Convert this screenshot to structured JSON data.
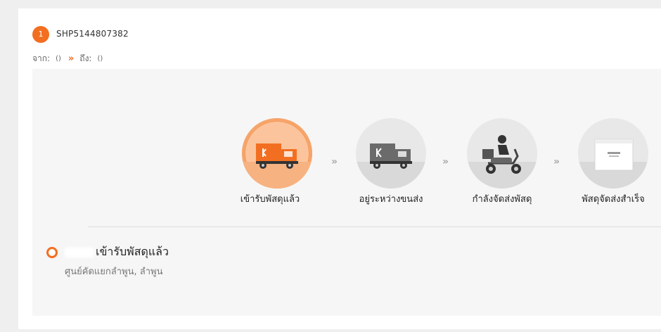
{
  "shipment": {
    "index": "1",
    "tracking_number": "SHP5144807382",
    "from_label": "จาก:",
    "from_value": "()",
    "to_label": "ถึง:",
    "to_value": "()",
    "route_arrow": "»"
  },
  "steps": [
    {
      "label": "เข้ารับพัสดุแล้ว",
      "icon": "orange-truck-icon",
      "active": true
    },
    {
      "label": "อยู่ระหว่างขนส่ง",
      "icon": "gray-truck-icon",
      "active": false
    },
    {
      "label": "กำลังจัดส่งพัสดุ",
      "icon": "scooter-courier-icon",
      "active": false
    },
    {
      "label": "พัสดุจัดส่งสำเร็จ",
      "icon": "package-box-icon",
      "active": false
    }
  ],
  "step_separator": "»",
  "status": {
    "title": "เข้ารับพัสดุแล้ว",
    "location": "ศูนย์คัดแยกลำพูน, ลำพูน"
  },
  "colors": {
    "accent": "#f26f21",
    "panel": "#f6f6f6",
    "page_bg": "#efefef"
  }
}
